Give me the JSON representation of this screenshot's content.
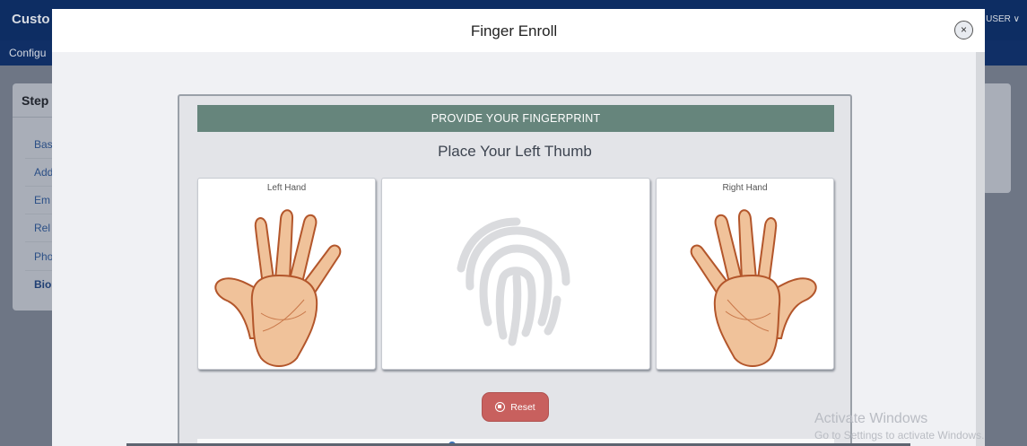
{
  "app": {
    "title": "Custo",
    "user": "USER",
    "subnav": "Configu",
    "steps_title": "Step",
    "steps": [
      "Bas",
      "Add",
      "Em",
      "Rel",
      "Pho",
      "Bio"
    ]
  },
  "modal": {
    "title": "Finger Enroll",
    "close_icon": "×",
    "banner": "PROVIDE YOUR FINGERPRINT",
    "instruction": "Place Your Left Thumb",
    "left_hand_label": "Left Hand",
    "right_hand_label": "Right Hand",
    "reset_label": "Reset"
  },
  "watermark": {
    "line1": "Activate Windows",
    "line2": "Go to Settings to activate Windows."
  },
  "colors": {
    "banner": "#66857c",
    "reset": "#c8605e",
    "topbar": "#0d2d63"
  },
  "icons": [
    "close-icon",
    "fingerprint-icon",
    "left-hand-icon",
    "right-hand-icon",
    "reset-icon",
    "chevron-down-icon"
  ]
}
